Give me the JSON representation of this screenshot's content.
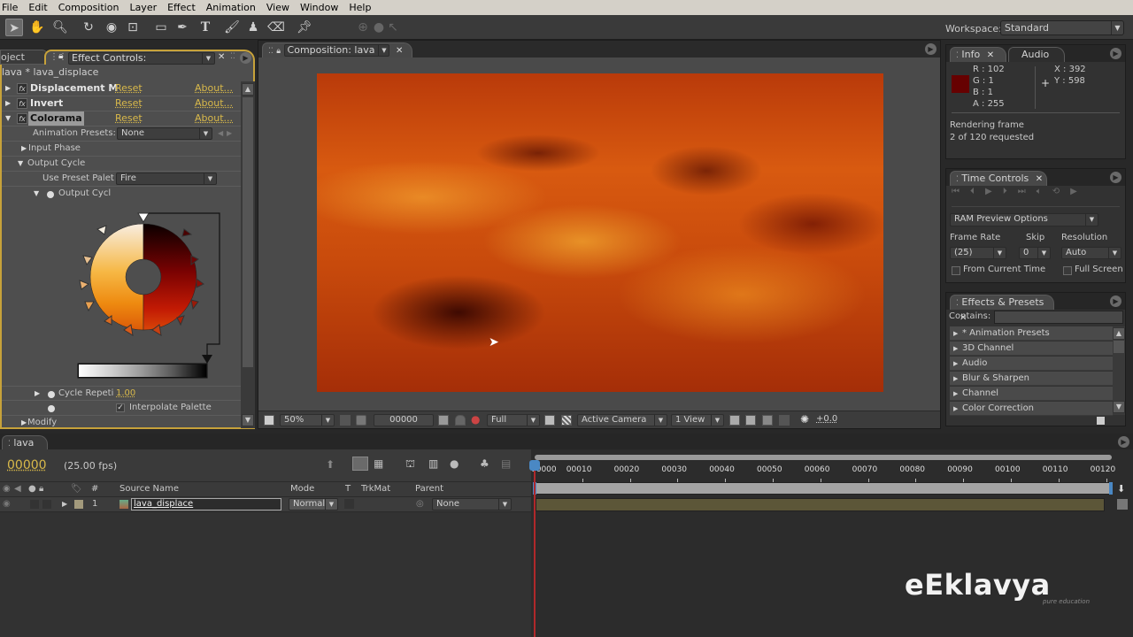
{
  "menubar": [
    "File",
    "Edit",
    "Composition",
    "Layer",
    "Effect",
    "Animation",
    "View",
    "Window",
    "Help"
  ],
  "toolbar": {
    "tools": [
      "selection-tool",
      "hand-tool",
      "zoom-tool",
      "rotation-tool",
      "orbit-camera-tool",
      "pan-behind-tool",
      "rectangle-tool",
      "pen-tool",
      "type-tool",
      "brush-tool",
      "clone-stamp-tool",
      "eraser-tool",
      "puppet-pin-tool"
    ],
    "workspace_label": "Workspace:",
    "workspace_value": "Standard"
  },
  "effect_controls": {
    "project_tab": "oject",
    "tab_label": "Effect Controls: lava_displace",
    "breadcrumb": "lava * lava_displace",
    "effects": [
      {
        "name": "Displacement M",
        "reset": "Reset",
        "about": "About...",
        "expanded": false
      },
      {
        "name": "Invert",
        "reset": "Reset",
        "about": "About...",
        "expanded": false
      },
      {
        "name": "Colorama",
        "reset": "Reset",
        "about": "About...",
        "expanded": true
      }
    ],
    "animation_presets_label": "Animation Presets:",
    "animation_presets_value": "None",
    "input_phase": "Input Phase",
    "output_cycle": "Output Cycle",
    "use_preset_label": "Use Preset Palet",
    "use_preset_value": "Fire",
    "output_cycl_label": "Output Cycl",
    "cycle_repeat_label": "Cycle Repeti",
    "cycle_repeat_value": "1.00",
    "interpolate_label": "Interpolate Palette",
    "interpolate_checked": true,
    "modify": "Modify"
  },
  "composition": {
    "tab_label": "Composition: lava",
    "zoom": "50%",
    "timecode": "00000",
    "resolution": "Full",
    "camera": "Active Camera",
    "views": "1 View",
    "exposure": "+0.0"
  },
  "info": {
    "tab_info": "Info",
    "tab_audio": "Audio",
    "swatch_color": "#660101",
    "r": "R : 102",
    "g": "G : 1",
    "b": "B : 1",
    "a": "A : 255",
    "x": "X : 392",
    "y": "Y : 598",
    "status_line1": "Rendering frame",
    "status_line2": "2 of 120 requested"
  },
  "time_controls": {
    "tab_label": "Time Controls",
    "ram_preview": "RAM Preview Options",
    "frame_rate_label": "Frame Rate",
    "frame_rate_value": "(25)",
    "skip_label": "Skip",
    "skip_value": "0",
    "resolution_label": "Resolution",
    "resolution_value": "Auto",
    "from_current_time": "From Current Time",
    "full_screen": "Full Screen"
  },
  "effects_presets": {
    "tab_label": "Effects & Presets",
    "contains_label": "Contains:",
    "contains_value": "",
    "items": [
      "* Animation Presets",
      "3D Channel",
      "Audio",
      "Blur & Sharpen",
      "Channel",
      "Color Correction"
    ]
  },
  "timeline": {
    "tab_label": "lava",
    "timecode": "00000",
    "fps": "(25.00 fps)",
    "columns": {
      "num": "#",
      "source": "Source Name",
      "mode": "Mode",
      "t": "T",
      "trkmat": "TrkMat",
      "parent": "Parent"
    },
    "layers": [
      {
        "num": "1",
        "source": "lava_displace",
        "mode": "Normal",
        "parent": "None"
      }
    ],
    "ruler_labels": [
      "00000",
      "00010",
      "00020",
      "00030",
      "00040",
      "00050",
      "00060",
      "00070",
      "00080",
      "00090",
      "00100",
      "00110",
      "00120"
    ]
  },
  "watermark": {
    "brand": "eEklavya",
    "tagline": "pure education"
  }
}
